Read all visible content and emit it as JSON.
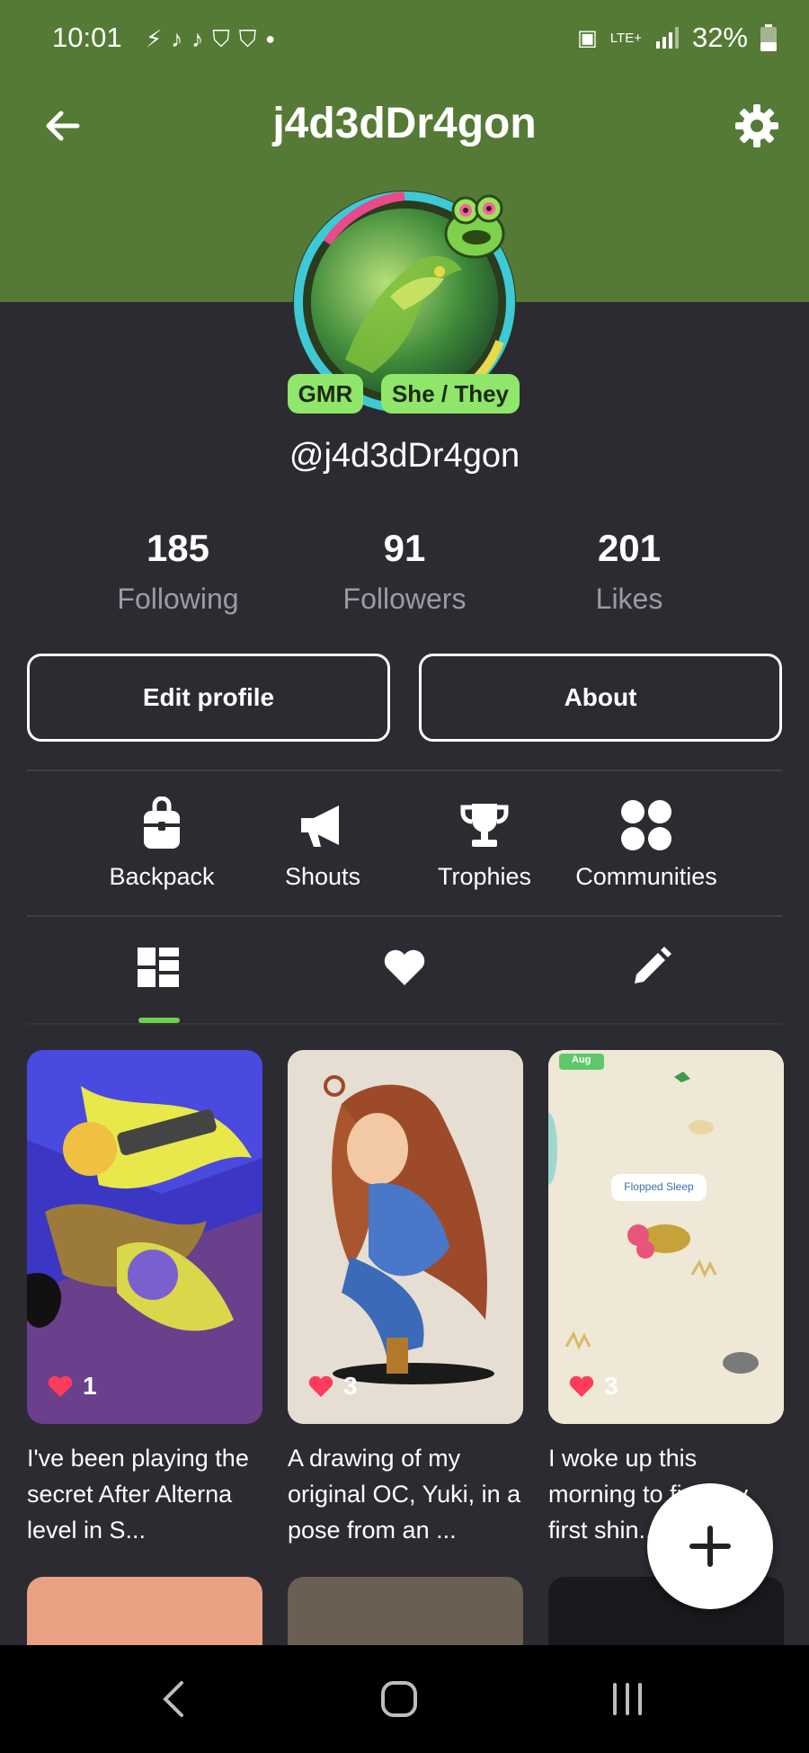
{
  "status_bar": {
    "time": "10:01",
    "network": "LTE+",
    "battery": "32%",
    "notification_icons": [
      "flash-icon",
      "tiktok-icon",
      "tiktok-icon",
      "brave-icon",
      "brave-icon",
      "dot-icon"
    ]
  },
  "header": {
    "title": "j4d3dDr4gon"
  },
  "profile": {
    "tags": [
      "GMR",
      "She / They"
    ],
    "handle": "@j4d3dDr4gon"
  },
  "stats": [
    {
      "value": "185",
      "label": "Following"
    },
    {
      "value": "91",
      "label": "Followers"
    },
    {
      "value": "201",
      "label": "Likes"
    }
  ],
  "buttons": {
    "edit_profile": "Edit profile",
    "about": "About"
  },
  "shortcuts": [
    {
      "label": "Backpack",
      "icon": "backpack-icon"
    },
    {
      "label": "Shouts",
      "icon": "megaphone-icon"
    },
    {
      "label": "Trophies",
      "icon": "trophy-icon"
    },
    {
      "label": "Communities",
      "icon": "communities-icon"
    }
  ],
  "tabs": [
    {
      "icon": "grid-icon",
      "selected": true
    },
    {
      "icon": "heart-icon",
      "selected": false
    },
    {
      "icon": "pencil-icon",
      "selected": false
    }
  ],
  "posts": [
    {
      "likes": "1",
      "caption": "I've been playing the secret After Alterna level in S..."
    },
    {
      "likes": "3",
      "caption": "A drawing of my original OC, Yuki, in a pose from an ..."
    },
    {
      "likes": "3",
      "caption": "I woke up this morning to find my first shin...",
      "thumb_text_tag": "Aug",
      "thumb_text_label": "Flopped Sleep"
    }
  ],
  "colors": {
    "header_green": "#557a35",
    "background": "#2b2b31",
    "accent_green": "#8fe66a",
    "like_red": "#ff3b5c"
  }
}
